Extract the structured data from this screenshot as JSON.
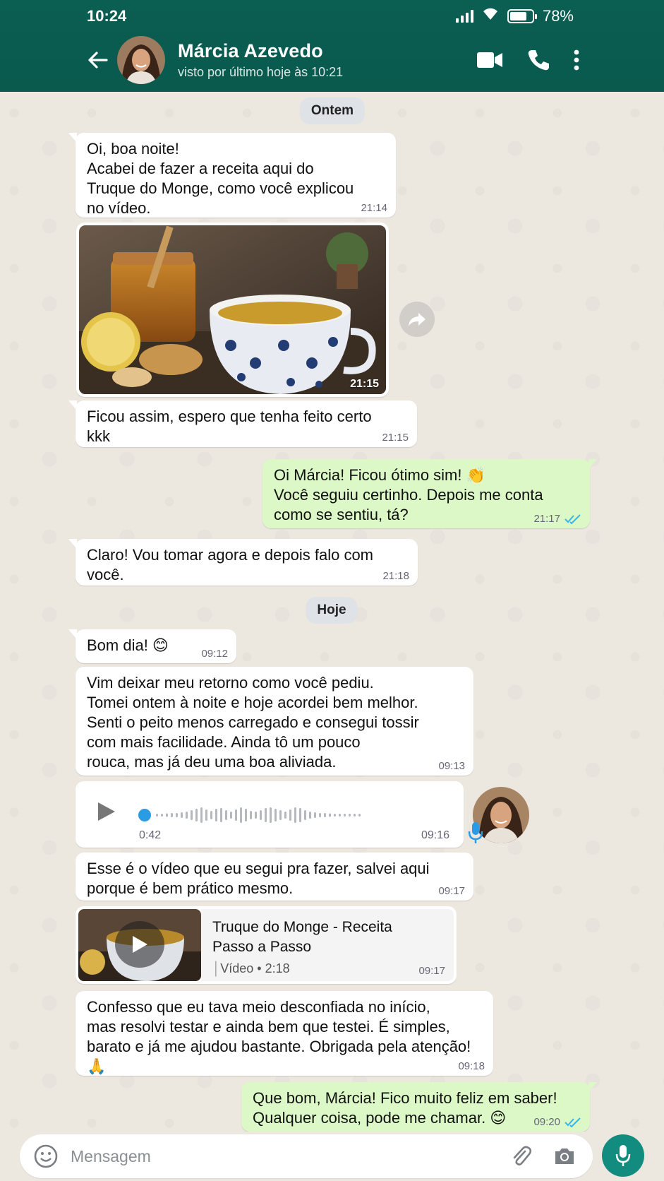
{
  "status_bar": {
    "time": "10:24",
    "battery_pct": "78%",
    "battery_level": 0.78
  },
  "contact": {
    "name": "Márcia Azevedo",
    "last_seen": "visto por último hoje às 10:21"
  },
  "header_icons": [
    "back-arrow-icon",
    "video-call-icon",
    "phone-icon",
    "more-vert-icon"
  ],
  "dates": {
    "yesterday": "Ontem",
    "today": "Hoje"
  },
  "messages": [
    {
      "dir": "in",
      "text": "Oi, boa noite!\nAcabei de fazer a receita aqui do\nTruque do Monge, como você explicou\nno vídeo.",
      "time": "21:14"
    },
    {
      "dir": "in",
      "type": "image",
      "time": "21:15"
    },
    {
      "dir": "in",
      "text": "Ficou assim, espero que tenha feito certo\nkkk",
      "time": "21:15"
    },
    {
      "dir": "out",
      "text": "Oi Márcia! Ficou ótimo sim! 👏\nVocê seguiu certinho. Depois me conta\ncomo se sentiu, tá?",
      "time": "21:17"
    },
    {
      "dir": "in",
      "text": "Claro! Vou tomar agora e depois falo com\nvocê.",
      "time": "21:18"
    },
    {
      "dir": "in",
      "text": "Bom dia! 😊",
      "time": "09:12"
    },
    {
      "dir": "in",
      "text": "Vim deixar meu retorno como você pediu.\nTomei ontem à noite e hoje acordei bem melhor.\nSenti o peito menos carregado e consegui tossir\ncom mais facilidade. Ainda tô um pouco\nrouca, mas já deu uma boa aliviada.",
      "time": "09:13"
    },
    {
      "dir": "in",
      "type": "voice",
      "duration": "0:42",
      "time": "09:16"
    },
    {
      "dir": "in",
      "text": "Esse é o vídeo que eu segui pra fazer, salvei aqui\nporque é bem prático mesmo.",
      "time": "09:17"
    },
    {
      "dir": "in",
      "type": "video",
      "title": "Truque do Monge - Receita Passo a Passo",
      "info": "Vídeo • 2:18",
      "time": "09:17"
    },
    {
      "dir": "in",
      "text": "Confesso que eu tava meio desconfiada no início,\nmas resolvi testar e ainda bem que testei. É simples,\nbarato e já me ajudou bastante. Obrigada pela atenção!\n🙏",
      "time": "09:18"
    },
    {
      "dir": "out",
      "text": "Que bom, Márcia! Fico muito feliz em saber!\nQualquer coisa, pode me chamar. 😊",
      "time": "09:20"
    }
  ],
  "input": {
    "placeholder": "Mensagem"
  },
  "colors": {
    "header": "#0b5e52",
    "outgoing": "#dcf8c6",
    "incoming": "#ffffff",
    "ticks": "#34b7f1",
    "mic_button": "#128c7e"
  }
}
